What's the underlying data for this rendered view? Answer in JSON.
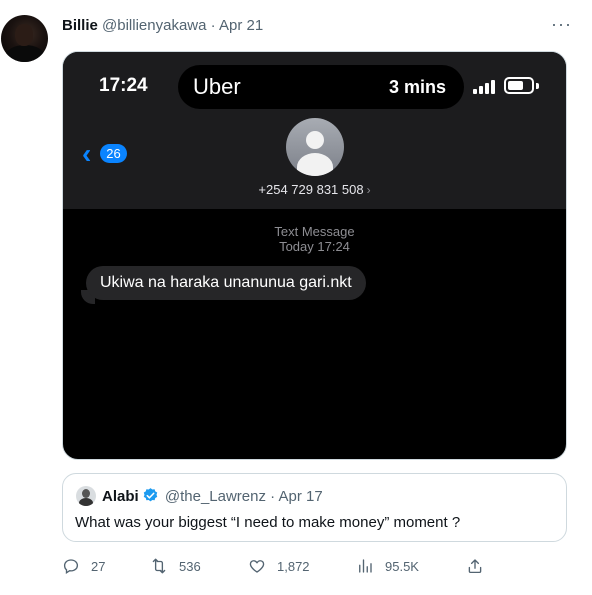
{
  "tweet": {
    "author_name": "Billie",
    "author_handle": "@billienyakawa",
    "separator": "·",
    "date": "Apr 21",
    "more_label": "···"
  },
  "screenshot": {
    "status_time": "17:24",
    "island_brand": "Uber",
    "island_eta": "3 mins",
    "back_count": "26",
    "phone_number": "+254 729 831 508",
    "message_label": "Text Message",
    "message_time": "Today 17:24",
    "message_text": "Ukiwa na haraka unanunua gari.nkt"
  },
  "quote": {
    "author_name": "Alabi",
    "author_handle": "@the_Lawrenz",
    "separator": "·",
    "date": "Apr 17",
    "text": "What was your biggest “I need to make money” moment ?"
  },
  "actions": {
    "replies": "27",
    "retweets": "536",
    "likes": "1,872",
    "views": "95.5K"
  },
  "colors": {
    "accent_blue": "#1d9bf0",
    "ios_blue": "#0a84ff",
    "secondary_text": "#536471"
  },
  "icons": [
    "reply-icon",
    "retweet-icon",
    "like-icon",
    "views-icon",
    "share-icon",
    "verified-badge-icon"
  ]
}
